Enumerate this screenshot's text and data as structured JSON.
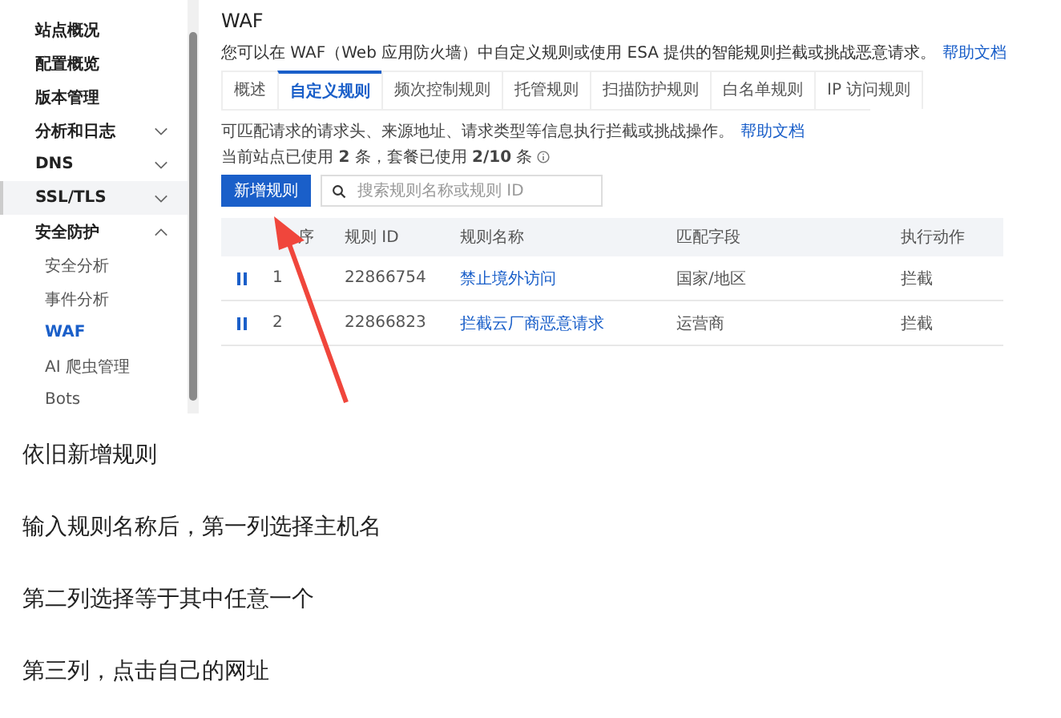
{
  "screenshot": {
    "sidebar": {
      "items": [
        {
          "kind": "group",
          "label": "站点概况",
          "highlighted": false
        },
        {
          "kind": "group",
          "label": "配置概览",
          "highlighted": false
        },
        {
          "kind": "group",
          "label": "版本管理",
          "highlighted": false
        },
        {
          "kind": "group",
          "label": "分析和日志",
          "expanded": false,
          "highlighted": false
        },
        {
          "kind": "group",
          "label": "DNS",
          "expanded": false,
          "highlighted": false
        },
        {
          "kind": "group",
          "label": "SSL/TLS",
          "expanded": false,
          "highlighted": true
        },
        {
          "kind": "group",
          "label": "安全防护",
          "expanded": true,
          "highlighted": false
        },
        {
          "kind": "child",
          "label": "安全分析",
          "selected": false
        },
        {
          "kind": "child",
          "label": "事件分析",
          "selected": false
        },
        {
          "kind": "child",
          "label": "WAF",
          "selected": true
        },
        {
          "kind": "child",
          "label": "AI 爬虫管理",
          "selected": false
        },
        {
          "kind": "child",
          "label": "Bots",
          "selected": false
        }
      ]
    },
    "title": "WAF",
    "description": "您可以在 WAF（Web 应用防火墙）中自定义规则或使用 ESA 提供的智能规则拦截或挑战恶意请求。",
    "help_link": "帮助文档",
    "tabs": [
      {
        "label": "概述",
        "selected": false
      },
      {
        "label": "自定义规则",
        "selected": true
      },
      {
        "label": "频次控制规则",
        "selected": false
      },
      {
        "label": "托管规则",
        "selected": false
      },
      {
        "label": "扫描防护规则",
        "selected": false
      },
      {
        "label": "白名单规则",
        "selected": false
      },
      {
        "label": "IP 访问规则",
        "selected": false
      }
    ],
    "note": "可匹配请求的请求头、来源地址、请求类型等信息执行拦截或挑战操作。",
    "note_link": "帮助文档",
    "usage": "当前站点已使用 **2** 条，套餐已使用 **2/10** 条",
    "add_button": "新增规则",
    "search": {
      "placeholder": "搜索规则名称或规则 ID"
    },
    "table": {
      "columns": [
        "序",
        "规则 ID",
        "规则名称",
        "匹配字段",
        "执行动作"
      ],
      "rows": [
        {
          "order": "1",
          "id": "22866754",
          "name": "禁止境外访问",
          "field": "国家/地区",
          "action": "拦截"
        },
        {
          "order": "2",
          "id": "22866823",
          "name": "拦截云厂商恶意请求",
          "field": "运营商",
          "action": "拦截"
        }
      ]
    }
  },
  "paragraphs": [
    "依旧新增规则",
    "输入规则名称后，第一列选择主机名",
    "第二列选择等于其中任意一个",
    "第三列，点击自己的网址"
  ]
}
